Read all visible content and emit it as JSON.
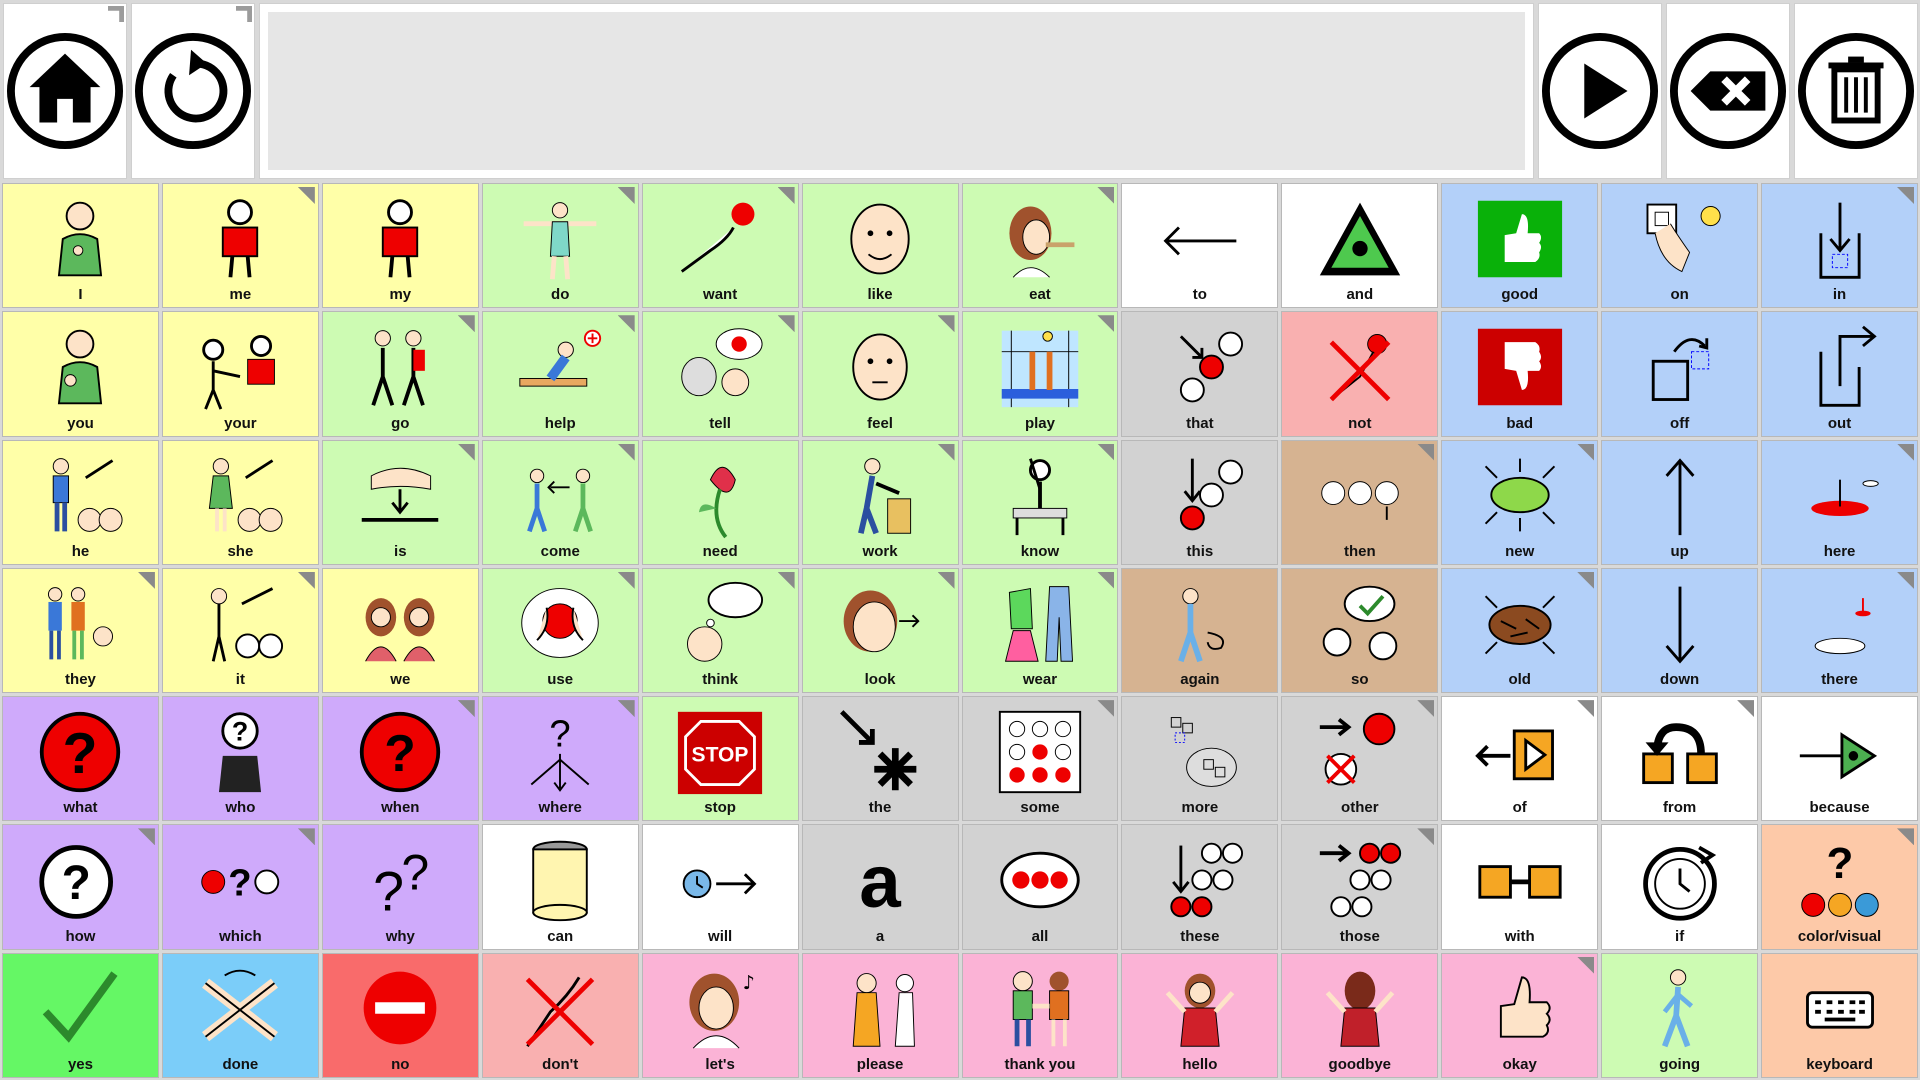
{
  "toolbar": {
    "home": "home-icon",
    "back": "back-icon",
    "speak": "play-icon",
    "backspace": "backspace-icon",
    "clear": "trash-icon",
    "message_text": ""
  },
  "colors": {
    "yellow": "#ffffa8",
    "green": "#cdfbb3",
    "white": "#ffffff",
    "blue": "#b3d0f9",
    "gray": "#d2d2d2",
    "pinkred": "#f9b0b0",
    "tan": "#d6b391",
    "purple": "#cfaafb",
    "pink": "#fbb3d6",
    "salmon": "#fdc9a8",
    "lime": "#65f765",
    "sky": "#7bcdf9",
    "red": "#f96b6b"
  },
  "cells": [
    {
      "label": "I",
      "color": "yellow",
      "icon": "person-self",
      "folder": false
    },
    {
      "label": "me",
      "color": "yellow",
      "icon": "person-red",
      "folder": true
    },
    {
      "label": "my",
      "color": "yellow",
      "icon": "person-red",
      "folder": false
    },
    {
      "label": "do",
      "color": "green",
      "icon": "person-arms",
      "folder": true
    },
    {
      "label": "want",
      "color": "green",
      "icon": "hand-ball",
      "folder": true
    },
    {
      "label": "like",
      "color": "green",
      "icon": "face-smile",
      "folder": false
    },
    {
      "label": "eat",
      "color": "green",
      "icon": "person-eat",
      "folder": true
    },
    {
      "label": "to",
      "color": "white",
      "icon": "arrow-left",
      "folder": false
    },
    {
      "label": "and",
      "color": "white",
      "icon": "triangle",
      "folder": false
    },
    {
      "label": "good",
      "color": "blue",
      "icon": "thumb-up",
      "folder": false
    },
    {
      "label": "on",
      "color": "blue",
      "icon": "switch-on",
      "folder": false
    },
    {
      "label": "in",
      "color": "blue",
      "icon": "in-box",
      "folder": true
    },
    {
      "label": "you",
      "color": "yellow",
      "icon": "person-you",
      "folder": false
    },
    {
      "label": "your",
      "color": "yellow",
      "icon": "person-give",
      "folder": false
    },
    {
      "label": "go",
      "color": "green",
      "icon": "people-walk",
      "folder": true
    },
    {
      "label": "help",
      "color": "green",
      "icon": "help-person",
      "folder": true
    },
    {
      "label": "tell",
      "color": "green",
      "icon": "tell",
      "folder": true
    },
    {
      "label": "feel",
      "color": "green",
      "icon": "face-plain",
      "folder": true
    },
    {
      "label": "play",
      "color": "green",
      "icon": "volleyball",
      "folder": true
    },
    {
      "label": "that",
      "color": "gray",
      "icon": "dots-that",
      "folder": false
    },
    {
      "label": "not",
      "color": "pinkred",
      "icon": "cross-ball",
      "folder": false
    },
    {
      "label": "bad",
      "color": "blue",
      "icon": "thumb-down",
      "folder": false
    },
    {
      "label": "off",
      "color": "blue",
      "icon": "off-box",
      "folder": false
    },
    {
      "label": "out",
      "color": "blue",
      "icon": "out-box",
      "folder": false
    },
    {
      "label": "he",
      "color": "yellow",
      "icon": "person-he",
      "folder": false
    },
    {
      "label": "she",
      "color": "yellow",
      "icon": "person-she",
      "folder": false
    },
    {
      "label": "is",
      "color": "green",
      "icon": "hand-is",
      "folder": true
    },
    {
      "label": "come",
      "color": "green",
      "icon": "come",
      "folder": true
    },
    {
      "label": "need",
      "color": "green",
      "icon": "flower",
      "folder": false
    },
    {
      "label": "work",
      "color": "green",
      "icon": "work",
      "folder": true
    },
    {
      "label": "know",
      "color": "green",
      "icon": "know",
      "folder": true
    },
    {
      "label": "this",
      "color": "gray",
      "icon": "dots-this",
      "folder": false
    },
    {
      "label": "then",
      "color": "tan",
      "icon": "clocks",
      "folder": true
    },
    {
      "label": "new",
      "color": "blue",
      "icon": "new-oval",
      "folder": true
    },
    {
      "label": "up",
      "color": "blue",
      "icon": "arrow-up",
      "folder": false
    },
    {
      "label": "here",
      "color": "blue",
      "icon": "here",
      "folder": true
    },
    {
      "label": "they",
      "color": "yellow",
      "icon": "people-they",
      "folder": true
    },
    {
      "label": "it",
      "color": "yellow",
      "icon": "person-it",
      "folder": true
    },
    {
      "label": "we",
      "color": "yellow",
      "icon": "people-we",
      "folder": false
    },
    {
      "label": "use",
      "color": "green",
      "icon": "use-ball",
      "folder": true
    },
    {
      "label": "think",
      "color": "green",
      "icon": "think",
      "folder": true
    },
    {
      "label": "look",
      "color": "green",
      "icon": "look",
      "folder": true
    },
    {
      "label": "wear",
      "color": "green",
      "icon": "clothes",
      "folder": true
    },
    {
      "label": "again",
      "color": "tan",
      "icon": "again",
      "folder": false
    },
    {
      "label": "so",
      "color": "tan",
      "icon": "so",
      "folder": false
    },
    {
      "label": "old",
      "color": "blue",
      "icon": "old-oval",
      "folder": true
    },
    {
      "label": "down",
      "color": "blue",
      "icon": "arrow-down",
      "folder": false
    },
    {
      "label": "there",
      "color": "blue",
      "icon": "there",
      "folder": true
    },
    {
      "label": "what",
      "color": "purple",
      "icon": "question-red",
      "folder": false
    },
    {
      "label": "who",
      "color": "purple",
      "icon": "who",
      "folder": false
    },
    {
      "label": "when",
      "color": "purple",
      "icon": "when",
      "folder": true
    },
    {
      "label": "where",
      "color": "purple",
      "icon": "where",
      "folder": true
    },
    {
      "label": "stop",
      "color": "green",
      "icon": "stop-sign",
      "folder": false
    },
    {
      "label": "the",
      "color": "gray",
      "icon": "the-star",
      "folder": false
    },
    {
      "label": "some",
      "color": "gray",
      "icon": "some-dots",
      "folder": true
    },
    {
      "label": "more",
      "color": "gray",
      "icon": "more",
      "folder": false
    },
    {
      "label": "other",
      "color": "gray",
      "icon": "other",
      "folder": true
    },
    {
      "label": "of",
      "color": "white",
      "icon": "of",
      "folder": true
    },
    {
      "label": "from",
      "color": "white",
      "icon": "from",
      "folder": true
    },
    {
      "label": "because",
      "color": "white",
      "icon": "because",
      "folder": false
    },
    {
      "label": "how",
      "color": "purple",
      "icon": "how",
      "folder": true
    },
    {
      "label": "which",
      "color": "purple",
      "icon": "which",
      "folder": true
    },
    {
      "label": "why",
      "color": "purple",
      "icon": "why",
      "folder": false
    },
    {
      "label": "can",
      "color": "white",
      "icon": "can",
      "folder": false
    },
    {
      "label": "will",
      "color": "white",
      "icon": "will",
      "folder": false
    },
    {
      "label": "a",
      "color": "gray",
      "icon": "letter-a",
      "folder": false
    },
    {
      "label": "all",
      "color": "gray",
      "icon": "all-dots",
      "folder": false
    },
    {
      "label": "these",
      "color": "gray",
      "icon": "these",
      "folder": false
    },
    {
      "label": "those",
      "color": "gray",
      "icon": "those",
      "folder": true
    },
    {
      "label": "with",
      "color": "white",
      "icon": "with",
      "folder": false
    },
    {
      "label": "if",
      "color": "white",
      "icon": "if-clock",
      "folder": false
    },
    {
      "label": "color/visual",
      "color": "salmon",
      "icon": "color-visual",
      "folder": true
    },
    {
      "label": "yes",
      "color": "lime",
      "icon": "check",
      "folder": false
    },
    {
      "label": "done",
      "color": "sky",
      "icon": "done",
      "folder": false
    },
    {
      "label": "no",
      "color": "red",
      "icon": "no-entry",
      "folder": false
    },
    {
      "label": "don't",
      "color": "pinkred",
      "icon": "dont",
      "folder": false
    },
    {
      "label": "let's",
      "color": "pink",
      "icon": "lets",
      "folder": false
    },
    {
      "label": "please",
      "color": "pink",
      "icon": "please",
      "folder": false
    },
    {
      "label": "thank you",
      "color": "pink",
      "icon": "thank-you",
      "folder": false
    },
    {
      "label": "hello",
      "color": "pink",
      "icon": "hello",
      "folder": false
    },
    {
      "label": "goodbye",
      "color": "pink",
      "icon": "goodbye",
      "folder": false
    },
    {
      "label": "okay",
      "color": "pink",
      "icon": "okay",
      "folder": true
    },
    {
      "label": "going",
      "color": "green",
      "icon": "going",
      "folder": false
    },
    {
      "label": "keyboard",
      "color": "salmon",
      "icon": "keyboard",
      "folder": false
    }
  ]
}
